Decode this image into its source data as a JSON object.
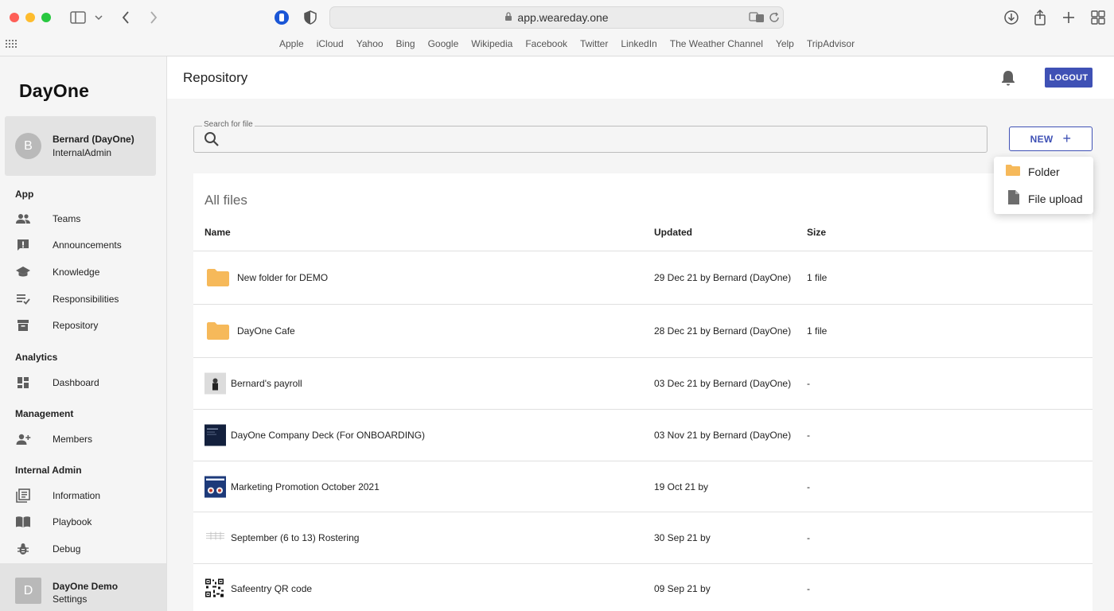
{
  "browser": {
    "url": "app.weareday.one",
    "favorites": [
      "Apple",
      "iCloud",
      "Yahoo",
      "Bing",
      "Google",
      "Wikipedia",
      "Facebook",
      "Twitter",
      "LinkedIn",
      "The Weather Channel",
      "Yelp",
      "TripAdvisor"
    ]
  },
  "sidebar": {
    "brand": "DayOne",
    "user": {
      "initial": "B",
      "name": "Bernard (DayOne)",
      "role": "InternalAdmin"
    },
    "sections": {
      "app": "App",
      "analytics": "Analytics",
      "management": "Management",
      "internal_admin": "Internal Admin"
    },
    "items": {
      "teams": "Teams",
      "announcements": "Announcements",
      "knowledge": "Knowledge",
      "responsibilities": "Responsibilities",
      "repository": "Repository",
      "dashboard": "Dashboard",
      "members": "Members",
      "information": "Information",
      "playbook": "Playbook",
      "debug": "Debug"
    },
    "footer": {
      "initial": "D",
      "name": "DayOne Demo",
      "sub": "Settings"
    }
  },
  "header": {
    "title": "Repository",
    "logout_label": "LOGOUT"
  },
  "search": {
    "label": "Search for file",
    "value": ""
  },
  "new_button": {
    "label": "NEW",
    "plus": "+"
  },
  "new_menu": {
    "folder": "Folder",
    "file_upload": "File upload"
  },
  "files": {
    "title": "All files",
    "columns": {
      "name": "Name",
      "updated": "Updated",
      "size": "Size"
    },
    "rows": [
      {
        "name": "New folder for DEMO",
        "updated": "29 Dec 21 by Bernard (DayOne)",
        "size": "1 file",
        "kind": "folder"
      },
      {
        "name": "DayOne Cafe",
        "updated": "28 Dec 21 by Bernard (DayOne)",
        "size": "1 file",
        "kind": "folder"
      },
      {
        "name": "Bernard's payroll",
        "updated": "03 Dec 21 by Bernard (DayOne)",
        "size": "-",
        "kind": "photo"
      },
      {
        "name": "DayOne Company Deck (For ONBOARDING)",
        "updated": "03 Nov 21 by Bernard (DayOne)",
        "size": "-",
        "kind": "deck"
      },
      {
        "name": "Marketing Promotion October 2021",
        "updated": "19 Oct 21 by",
        "size": "-",
        "kind": "promo"
      },
      {
        "name": "September (6 to 13) Rostering",
        "updated": "30 Sep 21 by",
        "size": "-",
        "kind": "sheet"
      },
      {
        "name": "Safeentry QR code",
        "updated": "09 Sep 21 by",
        "size": "-",
        "kind": "qr"
      }
    ]
  },
  "colors": {
    "primary": "#3f51b5",
    "folder": "#f6b95a"
  }
}
